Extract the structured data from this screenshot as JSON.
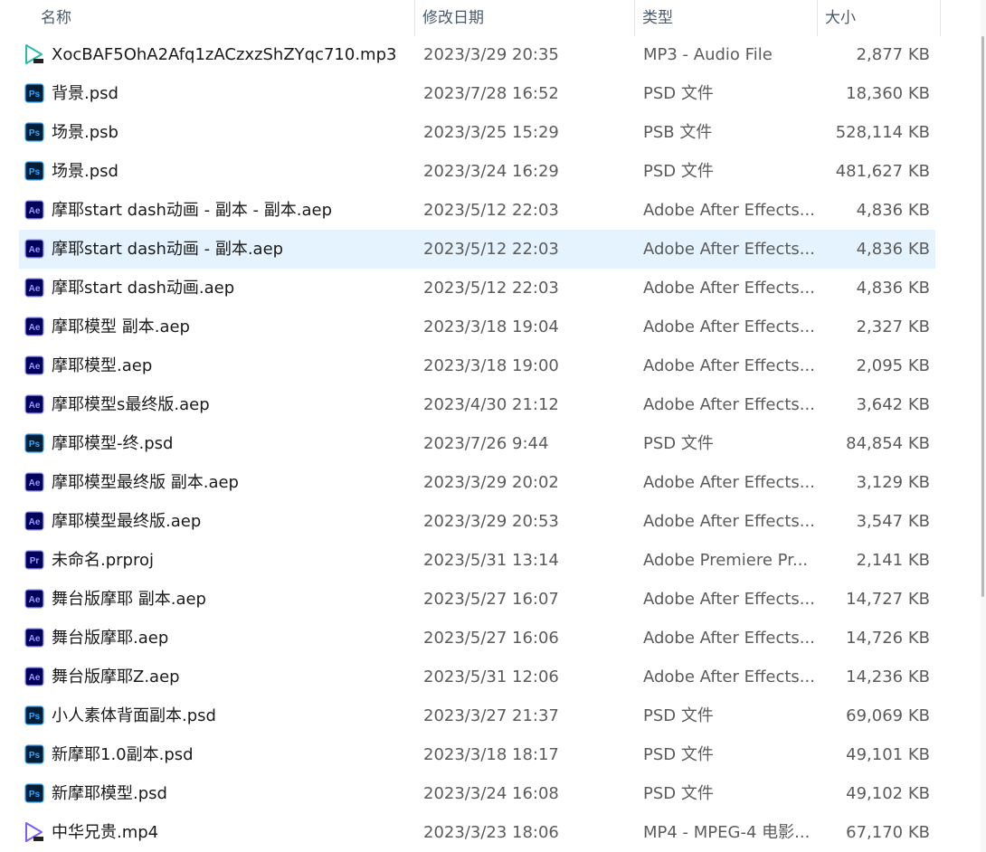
{
  "columns": {
    "name": "名称",
    "date": "修改日期",
    "type": "类型",
    "size": "大小"
  },
  "icon_colors": {
    "ps": "#31a8ff",
    "ae": "#9999ff",
    "pr": "#9999ff",
    "dark": "#001e36",
    "ae_dark": "#00005b",
    "media": "#2bbbad",
    "video": "#7b5cff"
  },
  "files": [
    {
      "name": "XocBAF5OhA2Afq1zACzxzShZYqc710.mp3",
      "date": "2023/3/29 20:35",
      "type": "MP3 - Audio File",
      "size": "2,877 KB",
      "icon": "mp3-file-icon",
      "selected": false
    },
    {
      "name": "背景.psd",
      "date": "2023/7/28 16:52",
      "type": "PSD 文件",
      "size": "18,360 KB",
      "icon": "photoshop-file-icon",
      "selected": false
    },
    {
      "name": "场景.psb",
      "date": "2023/3/25 15:29",
      "type": "PSB 文件",
      "size": "528,114 KB",
      "icon": "photoshop-psb-file-icon",
      "selected": false
    },
    {
      "name": "场景.psd",
      "date": "2023/3/24 16:29",
      "type": "PSD 文件",
      "size": "481,627 KB",
      "icon": "photoshop-file-icon",
      "selected": false
    },
    {
      "name": "摩耶start dash动画 - 副本 - 副本.aep",
      "date": "2023/5/12 22:03",
      "type": "Adobe After Effects...",
      "size": "4,836 KB",
      "icon": "after-effects-file-icon",
      "selected": false
    },
    {
      "name": "摩耶start dash动画 - 副本.aep",
      "date": "2023/5/12 22:03",
      "type": "Adobe After Effects...",
      "size": "4,836 KB",
      "icon": "after-effects-file-icon",
      "selected": true
    },
    {
      "name": "摩耶start dash动画.aep",
      "date": "2023/5/12 22:03",
      "type": "Adobe After Effects...",
      "size": "4,836 KB",
      "icon": "after-effects-file-icon",
      "selected": false
    },
    {
      "name": "摩耶模型 副本.aep",
      "date": "2023/3/18 19:04",
      "type": "Adobe After Effects...",
      "size": "2,327 KB",
      "icon": "after-effects-file-icon",
      "selected": false
    },
    {
      "name": "摩耶模型.aep",
      "date": "2023/3/18 19:00",
      "type": "Adobe After Effects...",
      "size": "2,095 KB",
      "icon": "after-effects-file-icon",
      "selected": false
    },
    {
      "name": "摩耶模型s最终版.aep",
      "date": "2023/4/30 21:12",
      "type": "Adobe After Effects...",
      "size": "3,642 KB",
      "icon": "after-effects-file-icon",
      "selected": false
    },
    {
      "name": "摩耶模型-终.psd",
      "date": "2023/7/26 9:44",
      "type": "PSD 文件",
      "size": "84,854 KB",
      "icon": "photoshop-file-icon",
      "selected": false
    },
    {
      "name": "摩耶模型最终版 副本.aep",
      "date": "2023/3/29 20:02",
      "type": "Adobe After Effects...",
      "size": "3,129 KB",
      "icon": "after-effects-file-icon",
      "selected": false
    },
    {
      "name": "摩耶模型最终版.aep",
      "date": "2023/3/29 20:53",
      "type": "Adobe After Effects...",
      "size": "3,547 KB",
      "icon": "after-effects-file-icon",
      "selected": false
    },
    {
      "name": "未命名.prproj",
      "date": "2023/5/31 13:14",
      "type": "Adobe Premiere Pr...",
      "size": "2,141 KB",
      "icon": "premiere-file-icon",
      "selected": false
    },
    {
      "name": "舞台版摩耶 副本.aep",
      "date": "2023/5/27 16:07",
      "type": "Adobe After Effects...",
      "size": "14,727 KB",
      "icon": "after-effects-file-icon",
      "selected": false
    },
    {
      "name": "舞台版摩耶.aep",
      "date": "2023/5/27 16:06",
      "type": "Adobe After Effects...",
      "size": "14,726 KB",
      "icon": "after-effects-file-icon",
      "selected": false
    },
    {
      "name": "舞台版摩耶Z.aep",
      "date": "2023/5/31 12:06",
      "type": "Adobe After Effects...",
      "size": "14,236 KB",
      "icon": "after-effects-file-icon",
      "selected": false
    },
    {
      "name": "小人素体背面副本.psd",
      "date": "2023/3/27 21:37",
      "type": "PSD 文件",
      "size": "69,069 KB",
      "icon": "photoshop-file-icon",
      "selected": false
    },
    {
      "name": "新摩耶1.0副本.psd",
      "date": "2023/3/18 18:17",
      "type": "PSD 文件",
      "size": "49,101 KB",
      "icon": "photoshop-file-icon",
      "selected": false
    },
    {
      "name": "新摩耶模型.psd",
      "date": "2023/3/24 16:08",
      "type": "PSD 文件",
      "size": "49,102 KB",
      "icon": "photoshop-file-icon",
      "selected": false
    },
    {
      "name": "中华兄贵.mp4",
      "date": "2023/3/23 18:06",
      "type": "MP4 - MPEG-4 电影...",
      "size": "67,170 KB",
      "icon": "mp4-file-icon",
      "selected": false
    }
  ]
}
